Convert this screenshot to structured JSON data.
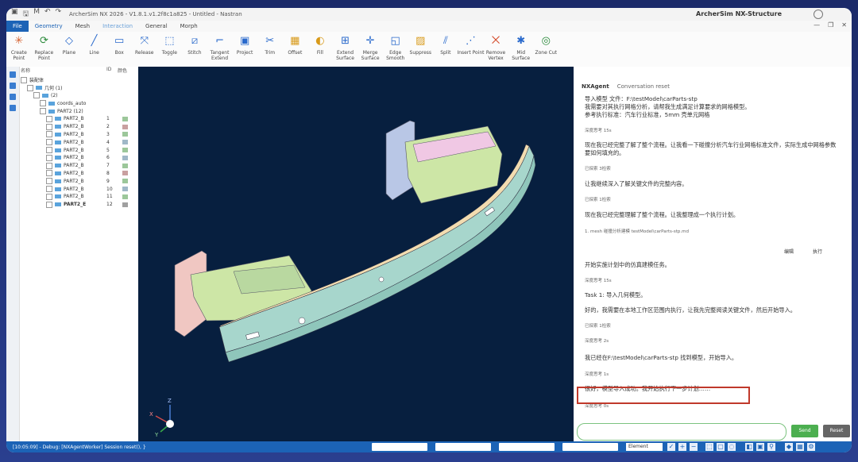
{
  "app": {
    "title": "ArcherSim NX 2026 - V1.8.1.v1.2f8c1a825 - Untitled - Nastran",
    "brand": "ArcherSim NX-Structure"
  },
  "menu": {
    "file": "File",
    "items": [
      "Geometry",
      "Mesh",
      "Interaction",
      "General",
      "Morph"
    ],
    "active_index": 2
  },
  "ribbon": {
    "tools": [
      {
        "label": "Create Point",
        "icon": "point-icon",
        "glyph": "✳",
        "color": "#d45c2a"
      },
      {
        "label": "Replace Point",
        "icon": "replace-icon",
        "glyph": "⟳",
        "color": "#2a8a3a"
      },
      {
        "label": "Plane",
        "icon": "plane-icon",
        "glyph": "◇",
        "color": "#2a6acc"
      },
      {
        "label": "Line",
        "icon": "line-icon",
        "glyph": "╱",
        "color": "#2a6acc"
      },
      {
        "label": "Box",
        "icon": "box-icon",
        "glyph": "▭",
        "color": "#2a6acc"
      },
      {
        "label": "Release",
        "icon": "release-icon",
        "glyph": "⤧",
        "color": "#2a6acc"
      },
      {
        "label": "Toggle",
        "icon": "toggle-icon",
        "glyph": "⬚",
        "color": "#2a6acc"
      },
      {
        "label": "Stitch",
        "icon": "stitch-icon",
        "glyph": "⧄",
        "color": "#2a6acc"
      },
      {
        "label": "Tangent Extend",
        "icon": "tangent-extend-icon",
        "glyph": "⌐",
        "color": "#2a6acc"
      },
      {
        "label": "Project",
        "icon": "project-icon",
        "glyph": "▣",
        "color": "#2a6acc"
      },
      {
        "label": "Trim",
        "icon": "trim-icon",
        "glyph": "✂",
        "color": "#2a6acc"
      },
      {
        "label": "Offset",
        "icon": "offset-icon",
        "glyph": "▦",
        "color": "#d89a1a"
      },
      {
        "label": "Fill",
        "icon": "fill-icon",
        "glyph": "◐",
        "color": "#d89a1a"
      },
      {
        "label": "Extend Surface",
        "icon": "extend-surface-icon",
        "glyph": "⊞",
        "color": "#2a6acc"
      },
      {
        "label": "Merge Surface",
        "icon": "merge-surface-icon",
        "glyph": "✛",
        "color": "#2a6acc"
      },
      {
        "label": "Edge Smooth",
        "icon": "edge-smooth-icon",
        "glyph": "◱",
        "color": "#2a6acc"
      },
      {
        "label": "Suppress",
        "icon": "suppress-icon",
        "glyph": "▨",
        "color": "#d89a1a"
      },
      {
        "label": "Split",
        "icon": "split-icon",
        "glyph": "⫽",
        "color": "#2a6acc"
      },
      {
        "label": "Insert Point",
        "icon": "insert-point-icon",
        "glyph": "⋰",
        "color": "#2a6acc"
      },
      {
        "label": "Remove Vertex",
        "icon": "remove-vertex-icon",
        "glyph": "⨉",
        "color": "#d44a2a"
      },
      {
        "label": "Mid Surface",
        "icon": "mid-surface-icon",
        "glyph": "✱",
        "color": "#2a6acc"
      },
      {
        "label": "Zone Cut",
        "icon": "zone-cut-icon",
        "glyph": "◎",
        "color": "#2a8a3a"
      }
    ]
  },
  "tree": {
    "headers": {
      "name": "名称",
      "id": "ID",
      "color": "颜色"
    },
    "rows": [
      {
        "label": "装配体",
        "indent": 0,
        "id": "",
        "color": ""
      },
      {
        "label": "几何  (1)",
        "indent": 1,
        "id": "",
        "color": ""
      },
      {
        "label": "(2)",
        "indent": 2,
        "id": "",
        "color": ""
      },
      {
        "label": "coords_auto",
        "indent": 3,
        "id": "",
        "color": ""
      },
      {
        "label": "PART2  (12)",
        "indent": 3,
        "id": "",
        "color": ""
      },
      {
        "label": "PART2_B",
        "indent": 4,
        "id": "1",
        "color": "#9cc79a"
      },
      {
        "label": "PART2_B",
        "indent": 4,
        "id": "2",
        "color": "#c9a0a0"
      },
      {
        "label": "PART2_B",
        "indent": 4,
        "id": "3",
        "color": "#9cc79a"
      },
      {
        "label": "PART2_B",
        "indent": 4,
        "id": "4",
        "color": "#a0b8c8"
      },
      {
        "label": "PART2_B",
        "indent": 4,
        "id": "5",
        "color": "#9cc79a"
      },
      {
        "label": "PART2_B",
        "indent": 4,
        "id": "6",
        "color": "#a0b8c8"
      },
      {
        "label": "PART2_B",
        "indent": 4,
        "id": "7",
        "color": "#9cc79a"
      },
      {
        "label": "PART2_B",
        "indent": 4,
        "id": "8",
        "color": "#c9a0a0"
      },
      {
        "label": "PART2_B",
        "indent": 4,
        "id": "9",
        "color": "#9cc79a"
      },
      {
        "label": "PART2_B",
        "indent": 4,
        "id": "10",
        "color": "#a0b8c8"
      },
      {
        "label": "PART2_B",
        "indent": 4,
        "id": "11",
        "color": "#9cc79a"
      },
      {
        "label": "PART2_E",
        "indent": 4,
        "id": "12",
        "color": "#a0a0a0",
        "bold": true
      }
    ]
  },
  "chat": {
    "title": "NXAgent",
    "reset_label": "Conversation reset",
    "messages": [
      {
        "text": "导入模型 文件：F:\\testModel\\carParts-stp",
        "kind": "big"
      },
      {
        "text": "我需要对其执行网格分析，请帮我生成满足计算要求的网格模型。",
        "kind": "big"
      },
      {
        "text": "参考执行标准：汽车行业标准，5mm 壳单元网格",
        "kind": "big"
      },
      {
        "text": "深度思考  15s",
        "kind": "small"
      },
      {
        "text": "现在我已经完整了解了整个流程。让我看一下碰撞分析汽车行业网格标准文件，实际生成中网格参数要如何填充的。",
        "kind": "big"
      },
      {
        "text": "已探索 3检索",
        "kind": "small"
      },
      {
        "text": "让我继续深入了解关键文件的完整内容。",
        "kind": "big"
      },
      {
        "text": "已探索 1检索",
        "kind": "small"
      },
      {
        "text": "现在我已经完整理解了整个流程。让我整理成一个执行计划。",
        "kind": "big"
      },
      {
        "text": "1. mesh 碰撞分析建模 testModel\\carParts-stp.md",
        "kind": "small"
      },
      {
        "text": "开始实施计划中的仿真建模任务。",
        "kind": "big"
      },
      {
        "text": "深度思考  15s",
        "kind": "small"
      },
      {
        "text": "Task 1: 导入几何模型。",
        "kind": "big"
      },
      {
        "text": "好的，我需要在本地工作区范围内执行，让我先完整阅读关键文件，然后开始导入。",
        "kind": "big"
      },
      {
        "text": "已探索 1检索",
        "kind": "small"
      },
      {
        "text": "深度思考  2s",
        "kind": "small"
      },
      {
        "text": "我已经在F:\\testModel\\carParts-stp 找到模型，开始导入。",
        "kind": "big"
      },
      {
        "text": "深度思考  1s",
        "kind": "small"
      },
      {
        "text": "很好，模型导入成功。我开始执行下一步计划……",
        "kind": "big"
      },
      {
        "text": "深度思考  0s",
        "kind": "small"
      }
    ],
    "actions": [
      "编辑",
      "执行"
    ],
    "input_placeholder": "",
    "send_label": "Send",
    "reset_button": "Reset",
    "footer_label": "Ready"
  },
  "status": {
    "text": "[10:05:09] - Debug: [NXAgentWorker] Session reset(), }",
    "filter": "Element"
  },
  "axis": {
    "x": "X",
    "y": "Y",
    "z": "Z"
  }
}
